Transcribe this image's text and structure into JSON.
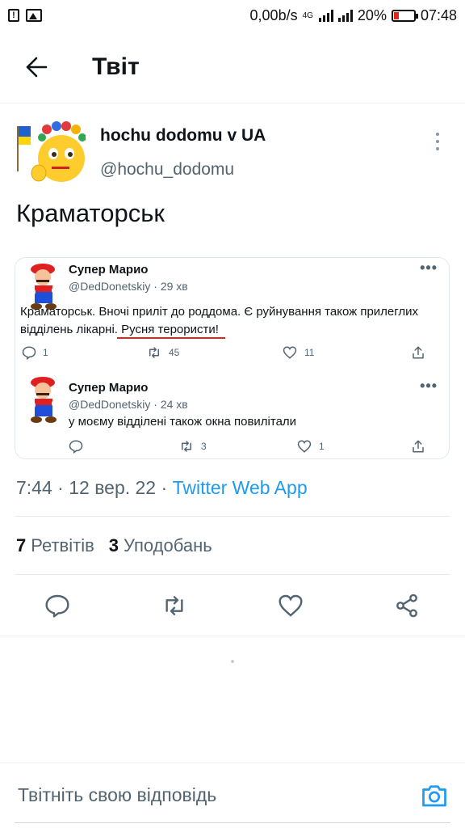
{
  "status_bar": {
    "speed": "0,00b/s",
    "network": "4G",
    "battery": "20%",
    "time": "07:48"
  },
  "header": {
    "title": "Твіт"
  },
  "tweet": {
    "author_name": "hochu dodomu v UA",
    "author_handle": "@hochu_dodomu",
    "text": "Краматорськ",
    "time": "7:44",
    "date": "12 вер. 22",
    "source": "Twitter Web App",
    "retweets_count": "7",
    "retweets_label": "Ретвітів",
    "likes_count": "3",
    "likes_label": "Уподобань"
  },
  "embedded": {
    "post1": {
      "name": "Супер Марио",
      "handle": "@DedDonetskiy",
      "age": "29 хв",
      "line1": "Краматорськ.  Вночі приліт до роддома. Є руйнування також прилеглих",
      "line2_a": "відділень лікарні. ",
      "line2_b": "Русня терористи!",
      "replies": "1",
      "retweets": "45",
      "likes": "11"
    },
    "post2": {
      "name": "Супер Марио",
      "handle": "@DedDonetskiy",
      "age": "24 хв",
      "text": "у моєму відділені також окна повилітали",
      "retweets": "3",
      "likes": "1"
    }
  },
  "reply_bar": {
    "placeholder": "Твітніть свою відповідь"
  },
  "colors": {
    "accent": "#1d9bf0",
    "text": "#0f1419",
    "secondary": "#536471",
    "underline": "#e0241e"
  },
  "icons": [
    "warning-icon",
    "image-icon",
    "back-arrow-icon",
    "more-vertical-icon",
    "reply-icon",
    "retweet-icon",
    "like-icon",
    "share-icon",
    "camera-icon"
  ]
}
